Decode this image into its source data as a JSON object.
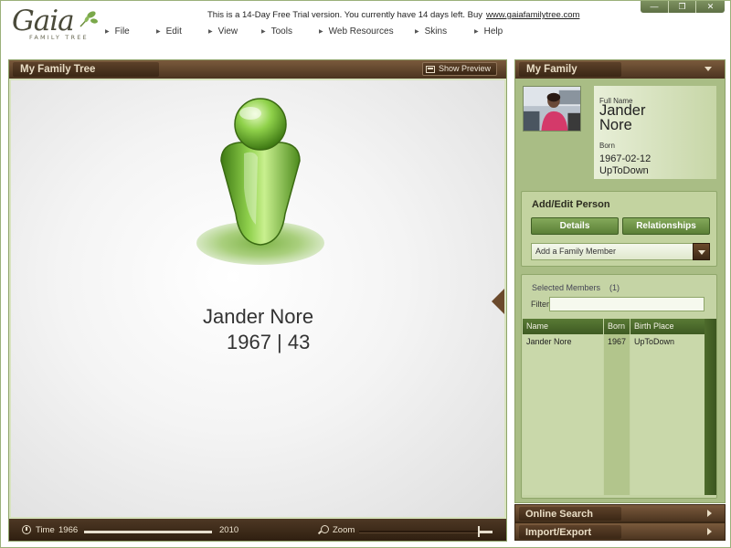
{
  "app": {
    "logo_text": "Gaia",
    "logo_subtext": "FAMILY TREE",
    "trial_notice": "This is a 14-Day Free Trial version. You currently have 14 days left. Buy",
    "trial_link": "www.gaiafamilytree.com"
  },
  "menu": {
    "items": [
      {
        "label": "File"
      },
      {
        "label": "Edit"
      },
      {
        "label": "View"
      },
      {
        "label": "Tools"
      },
      {
        "label": "Web Resources"
      },
      {
        "label": "Skins"
      },
      {
        "label": "Help"
      }
    ]
  },
  "window_controls": {
    "minimize": "—",
    "maximize": "❐",
    "close": "✕"
  },
  "tree_panel": {
    "title": "My Family Tree",
    "show_preview_label": "Show Preview",
    "person_name": "Jander Nore",
    "person_years": "1967 | 43",
    "time_label": "Time",
    "time_start": "1966",
    "time_end": "2010",
    "zoom_label": "Zoom",
    "zoom_level": 0.9
  },
  "family_panel": {
    "title": "My Family",
    "full_name_label": "Full Name",
    "first_name": "Jander",
    "last_name": "Nore",
    "born_label": "Born",
    "born_date": "1967-02-12",
    "born_place": "UpToDown"
  },
  "add_edit": {
    "title": "Add/Edit Person",
    "details_button": "Details",
    "relationships_button": "Relationships",
    "dropdown_value": "Add a Family Member"
  },
  "selected_members": {
    "title": "Selected Members",
    "count": "(1)",
    "filter_label": "Filter",
    "filter_value": "",
    "columns": [
      "Name",
      "Born",
      "Birth Place"
    ],
    "rows": [
      {
        "name": "Jander Nore",
        "born": "1967",
        "place": "UpToDown"
      }
    ]
  },
  "accordion": {
    "online_search": "Online Search",
    "import_export": "Import/Export"
  },
  "colors": {
    "accent_green": "#7aa84a",
    "header_brown": "#4b3420",
    "panel_green": "#a9bd85"
  }
}
